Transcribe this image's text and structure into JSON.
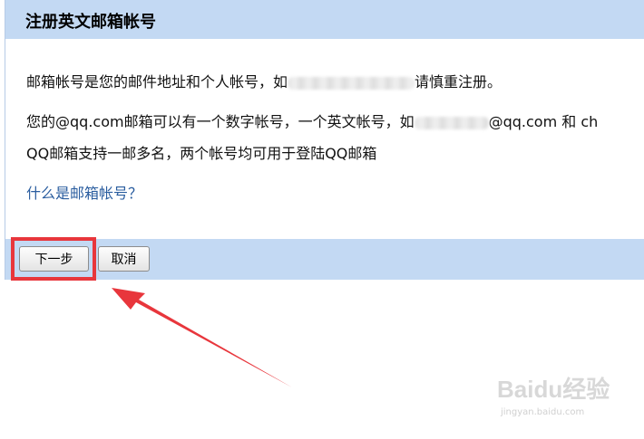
{
  "dialog": {
    "title": "注册英文邮箱帐号",
    "line1_prefix": "邮箱帐号是您的邮件地址和个人帐号，如",
    "line1_suffix": "请慎重注册。",
    "line2_prefix": "您的@qq.com邮箱可以有一个数字帐号，一个英文帐号，如",
    "line2_suffix": "@qq.com 和 ch",
    "line3": "QQ邮箱支持一邮多名，两个帐号均可用于登陆QQ邮箱",
    "help_link": "什么是邮箱帐号？"
  },
  "footer": {
    "next_label": "下一步",
    "cancel_label": "取消"
  },
  "annotation": {
    "highlight_color": "#e8363c"
  },
  "watermark": {
    "logo": "Baidu经验",
    "url": "jingyan.baidu.com"
  }
}
